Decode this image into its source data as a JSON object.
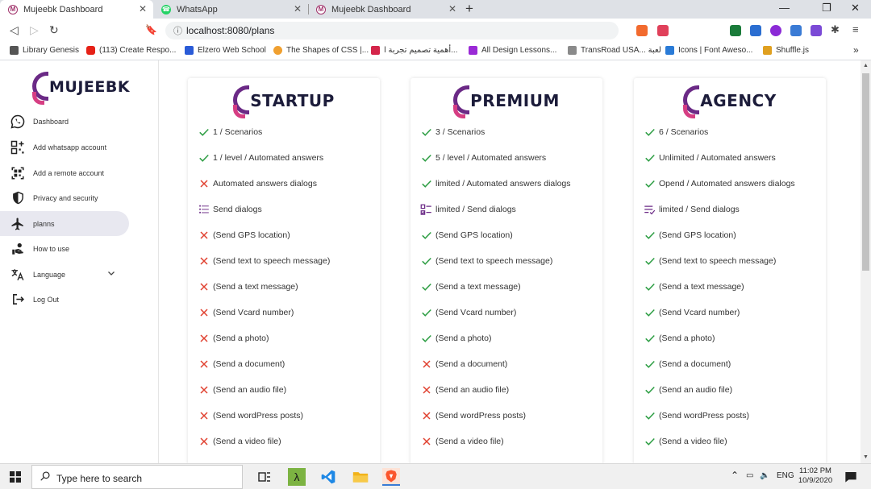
{
  "browser": {
    "tabs": [
      {
        "title": "Mujeebk Dashboard",
        "icon": "M"
      },
      {
        "title": "WhatsApp",
        "icon": "whatsapp-icon"
      },
      {
        "title": "Mujeebk Dashboard",
        "icon": "M"
      }
    ],
    "new_tab": "+",
    "url": "localhost:8080/plans",
    "bookmarks": [
      "Library Genesis",
      "(113) Create Respo...",
      "Elzero Web School",
      "The Shapes of CSS |...",
      "أهمية تصميم تجربة ا...",
      "All Design Lessons...",
      "TransRoad USA... لعبة",
      "Icons | Font Aweso...",
      "Shuffle.js"
    ],
    "bookmarks_more": "»"
  },
  "sidebar": {
    "logo": "MUJEEBK",
    "items": [
      {
        "label": "Dashboard",
        "icon": "whatsapp-icon"
      },
      {
        "label": "Add whatsapp account",
        "icon": "qr-add-icon"
      },
      {
        "label": "Add a remote account",
        "icon": "qr-scan-icon"
      },
      {
        "label": "Privacy and security",
        "icon": "shield-icon"
      },
      {
        "label": "planns",
        "icon": "plane-icon"
      },
      {
        "label": "How to use",
        "icon": "hand-icon"
      },
      {
        "label": "Language",
        "icon": "translate-icon"
      },
      {
        "label": "Log Out",
        "icon": "logout-icon"
      }
    ]
  },
  "plans": [
    {
      "name": "STARTUP",
      "features": [
        {
          "text": "1 / Scenarios",
          "status": "check"
        },
        {
          "text": "1 / level / Automated answers",
          "status": "check"
        },
        {
          "text": "Automated answers dialogs",
          "status": "cross"
        },
        {
          "text": "Send dialogs",
          "status": "list"
        },
        {
          "text": "(Send GPS location)",
          "status": "cross"
        },
        {
          "text": "(Send text to speech message)",
          "status": "cross"
        },
        {
          "text": "(Send a text message)",
          "status": "cross"
        },
        {
          "text": "(Send Vcard number)",
          "status": "cross"
        },
        {
          "text": "(Send a photo)",
          "status": "cross"
        },
        {
          "text": "(Send a document)",
          "status": "cross"
        },
        {
          "text": "(Send an audio file)",
          "status": "cross"
        },
        {
          "text": "(Send wordPress posts)",
          "status": "cross"
        },
        {
          "text": "(Send a video file)",
          "status": "cross"
        }
      ]
    },
    {
      "name": "PREMIUM",
      "features": [
        {
          "text": "3 / Scenarios",
          "status": "check"
        },
        {
          "text": "5 / level / Automated answers",
          "status": "check"
        },
        {
          "text": "limited / Automated answers dialogs",
          "status": "check"
        },
        {
          "text": "limited / Send dialogs",
          "status": "checklist"
        },
        {
          "text": "(Send GPS location)",
          "status": "check"
        },
        {
          "text": "(Send text to speech message)",
          "status": "check"
        },
        {
          "text": "(Send a text message)",
          "status": "check"
        },
        {
          "text": "(Send Vcard number)",
          "status": "check"
        },
        {
          "text": "(Send a photo)",
          "status": "check"
        },
        {
          "text": "(Send a document)",
          "status": "cross"
        },
        {
          "text": "(Send an audio file)",
          "status": "cross"
        },
        {
          "text": "(Send wordPress posts)",
          "status": "cross"
        },
        {
          "text": "(Send a video file)",
          "status": "cross"
        }
      ]
    },
    {
      "name": "AGENCY",
      "features": [
        {
          "text": "6 / Scenarios",
          "status": "check"
        },
        {
          "text": "Unlimited / Automated answers",
          "status": "check"
        },
        {
          "text": "Opend / Automated answers dialogs",
          "status": "check"
        },
        {
          "text": "limited / Send dialogs",
          "status": "playlist"
        },
        {
          "text": "(Send GPS location)",
          "status": "check"
        },
        {
          "text": "(Send text to speech message)",
          "status": "check"
        },
        {
          "text": "(Send a text message)",
          "status": "check"
        },
        {
          "text": "(Send Vcard number)",
          "status": "check"
        },
        {
          "text": "(Send a photo)",
          "status": "check"
        },
        {
          "text": "(Send a document)",
          "status": "check"
        },
        {
          "text": "(Send an audio file)",
          "status": "check"
        },
        {
          "text": "(Send wordPress posts)",
          "status": "check"
        },
        {
          "text": "(Send a video file)",
          "status": "check"
        }
      ]
    }
  ],
  "colors": {
    "check": "#2e9e44",
    "cross": "#e0402f",
    "list": "#6b2a86",
    "brand_purple": "#6b2a86",
    "brand_pink": "#d63e83"
  },
  "taskbar": {
    "search_placeholder": "Type here to search",
    "language": "ENG",
    "time": "11:02 PM",
    "date": "10/9/2020"
  }
}
